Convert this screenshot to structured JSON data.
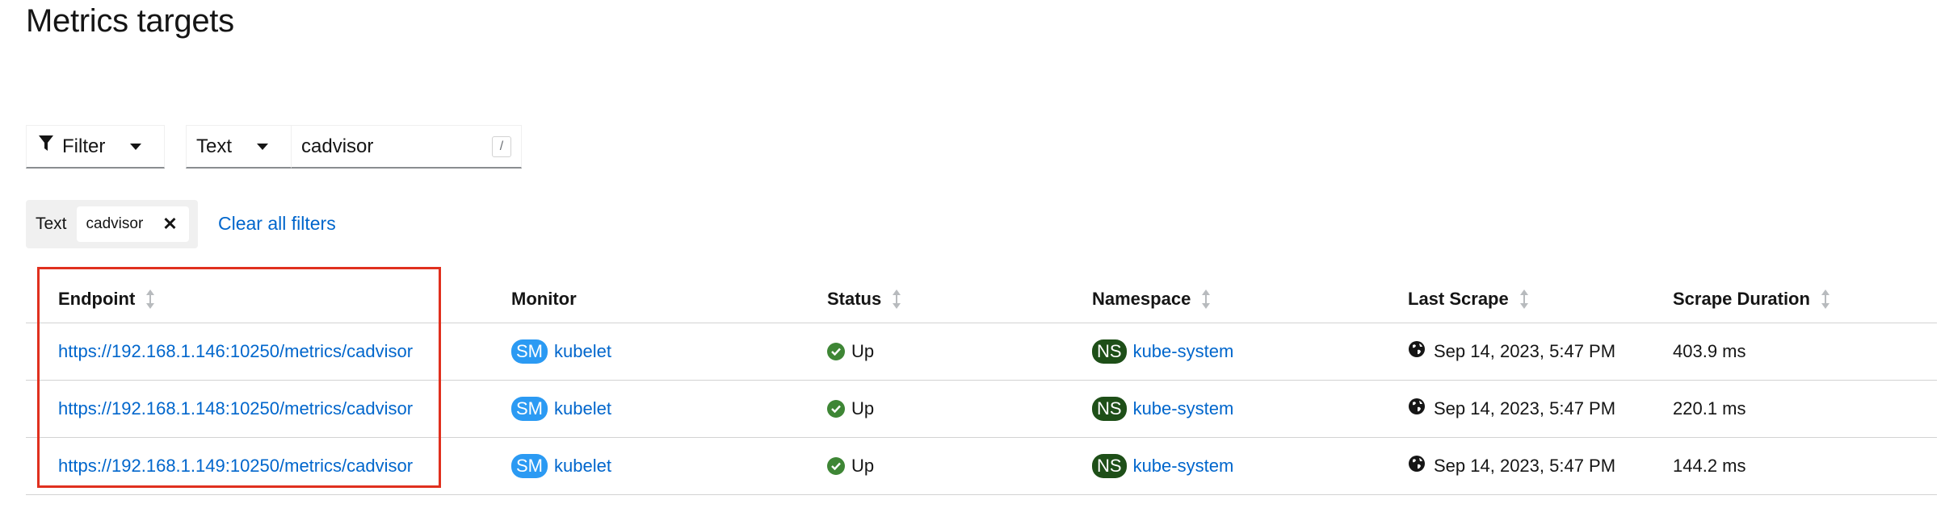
{
  "page": {
    "title": "Metrics targets"
  },
  "toolbar": {
    "filter_label": "Filter",
    "type_label": "Text",
    "search_value": "cadvisor",
    "shortcut_hint": "/"
  },
  "chips": {
    "group_label": "Text",
    "chip_label": "cadvisor",
    "clear_label": "Clear all filters"
  },
  "table": {
    "headers": {
      "endpoint": "Endpoint",
      "monitor": "Monitor",
      "status": "Status",
      "namespace": "Namespace",
      "last_scrape": "Last Scrape",
      "duration": "Scrape Duration"
    },
    "rows": [
      {
        "endpoint": "https://192.168.1.146:10250/metrics/cadvisor",
        "monitor_badge": "SM",
        "monitor": "kubelet",
        "status": "Up",
        "ns_badge": "NS",
        "namespace": "kube-system",
        "last_scrape": "Sep 14, 2023, 5:47 PM",
        "duration": "403.9 ms"
      },
      {
        "endpoint": "https://192.168.1.148:10250/metrics/cadvisor",
        "monitor_badge": "SM",
        "monitor": "kubelet",
        "status": "Up",
        "ns_badge": "NS",
        "namespace": "kube-system",
        "last_scrape": "Sep 14, 2023, 5:47 PM",
        "duration": "220.1 ms"
      },
      {
        "endpoint": "https://192.168.1.149:10250/metrics/cadvisor",
        "monitor_badge": "SM",
        "monitor": "kubelet",
        "status": "Up",
        "ns_badge": "NS",
        "namespace": "kube-system",
        "last_scrape": "Sep 14, 2023, 5:47 PM",
        "duration": "144.2 ms"
      }
    ]
  },
  "colors": {
    "link": "#0066cc",
    "sm_badge": "#2b9af3",
    "ns_badge": "#1e4f18",
    "status_ok": "#3e8635",
    "highlight": "#e0301e"
  },
  "icons": [
    "filter-icon",
    "caret-down-icon",
    "close-icon",
    "sort-icon",
    "check-circle-icon",
    "globe-icon"
  ]
}
